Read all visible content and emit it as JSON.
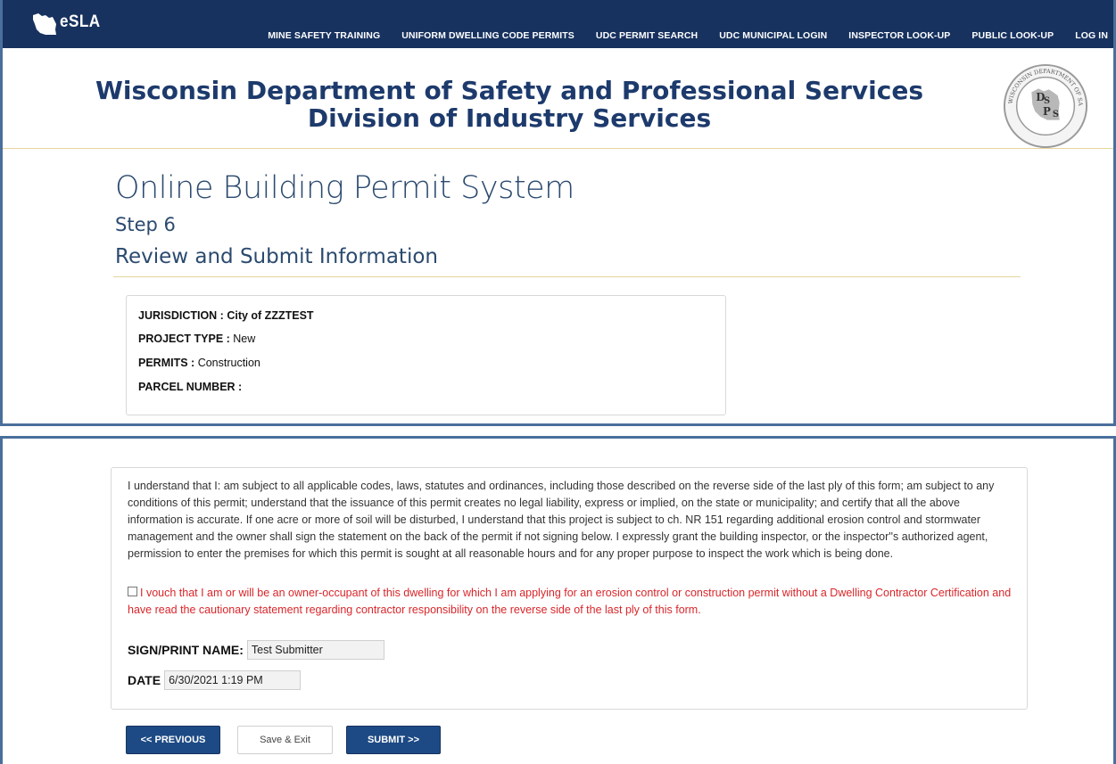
{
  "header": {
    "logo_text": "eSLA",
    "nav": [
      "MINE SAFETY TRAINING",
      "UNIFORM DWELLING CODE PERMITS",
      "UDC PERMIT SEARCH",
      "UDC MUNICIPAL LOGIN",
      "INSPECTOR LOOK-UP",
      "PUBLIC LOOK-UP",
      "LOG IN"
    ],
    "dept_line1": "Wisconsin Department of Safety and Professional Services",
    "dept_line2": "Division of Industry Services",
    "seal_text": "WISCONSIN DEPARTMENT OF SAFETY AND PROFESSIONAL SERVICES",
    "seal_letters": "DSPS"
  },
  "page": {
    "title": "Online Building Permit System",
    "step": "Step 6",
    "subtitle": "Review and Submit Information"
  },
  "summary": {
    "jurisdiction_label": "JURISDICTION :",
    "jurisdiction_value": "City of ZZZTEST",
    "project_type_label": "PROJECT TYPE :",
    "project_type_value": "New",
    "permits_label": "PERMITS :",
    "permits_value": "Construction",
    "parcel_label": "PARCEL NUMBER :",
    "parcel_value": ""
  },
  "statement": {
    "text": "I understand that I: am subject to all applicable codes, laws, statutes and ordinances, including those described on the reverse side of the last ply of this form; am subject to any conditions of this permit; understand that the issuance of this permit creates no legal liability, express or implied, on the state or municipality; and certify that all the above information is accurate. If one acre or more of soil will be disturbed, I understand that this project is subject to ch. NR 151 regarding additional erosion control and stormwater management and the owner shall sign the statement on the back of the permit if not signing below. I expressly grant the building inspector, or the inspector''s authorized agent, permission to enter the premises for which this permit is sought at all reasonable hours and for any proper purpose to inspect the work which is being done.",
    "vouch_text": "I vouch that I am or will be an owner-occupant of this dwelling for which I am applying for an erosion control or construction permit without a Dwelling Contractor Certification and have read the cautionary statement regarding contractor responsibility on the reverse side of the last ply of this form.",
    "vouch_checked": false
  },
  "form": {
    "sign_label": "SIGN/PRINT NAME:",
    "sign_value": "Test Submitter",
    "date_label": "DATE",
    "date_value": "6/30/2021 1:19 PM"
  },
  "buttons": {
    "previous": "<< PREVIOUS",
    "save_exit": "Save & Exit",
    "submit": "SUBMIT >>"
  },
  "colors": {
    "navbar": "#17325f",
    "heading": "#2b4a6f",
    "dept_title": "#1d3a6c",
    "warning_red": "#d9262a",
    "button_blue": "#1d4a84"
  }
}
